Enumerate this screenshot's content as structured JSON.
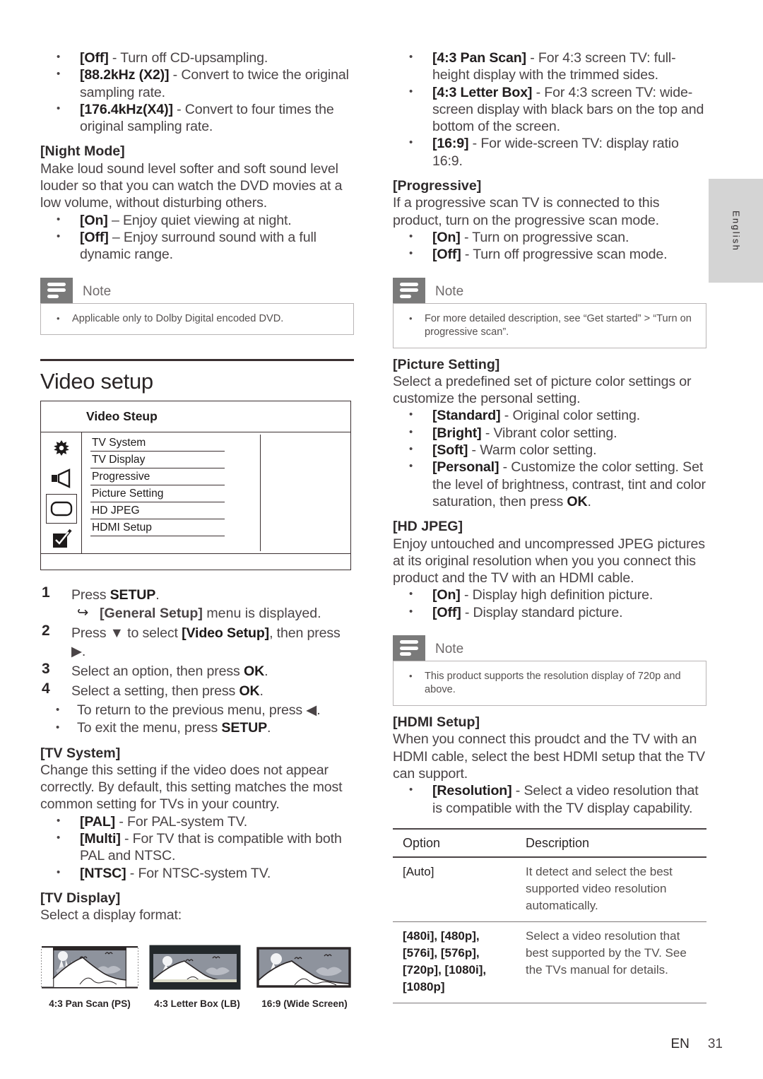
{
  "lang_tab": {
    "label": "English"
  },
  "footer": {
    "code": "EN",
    "page": "31"
  },
  "left": {
    "upsampling_bullets": [
      {
        "term": "[Off]",
        "rest": " - Turn off CD-upsampling."
      },
      {
        "term": "[88.2kHz (X2)]",
        "rest": " - Convert to twice the original sampling rate."
      },
      {
        "term": "[176.4kHz(X4)]",
        "rest": " - Convert to four times the original sampling rate."
      }
    ],
    "night_mode": {
      "heading": "[Night Mode]",
      "body": "Make loud sound level softer and soft sound level louder so that you can watch the DVD movies at a low volume, without disturbing others.",
      "bullets": [
        {
          "term": "[On]",
          "rest": " – Enjoy quiet viewing at night."
        },
        {
          "term": "[Off]",
          "rest": " – Enjoy surround sound with a full dynamic range."
        }
      ]
    },
    "note1": {
      "title": "Note",
      "items": [
        "Applicable only to Dolby Digital encoded DVD."
      ]
    },
    "section": {
      "title": "Video setup"
    },
    "osd": {
      "title": "Video Steup",
      "items": [
        "TV System",
        "TV Display",
        "Progressive",
        "Picture Setting",
        "HD JPEG",
        "HDMI Setup"
      ],
      "icons": [
        "gear-icon",
        "speaker-icon",
        "tv-screen-icon",
        "checkbox-icon"
      ]
    },
    "steps": [
      {
        "num": "1",
        "text_html": "Press <b>SETUP</b>.",
        "sub": "<b>[General Setup]</b> menu is displayed."
      },
      {
        "num": "2",
        "text_html": "Press ▼ to select <b>[Video Setup]</b>, then press ▶."
      },
      {
        "num": "3",
        "text_html": "Select an option, then press <b>OK</b>."
      },
      {
        "num": "4",
        "text_html": "Select a setting, then press <b>OK</b>."
      }
    ],
    "step_bullets": [
      "To return to the previous menu, press ◀.",
      "To exit the menu, press <b>SETUP</b>."
    ],
    "tv_system": {
      "heading": "[TV System]",
      "body": "Change this setting if the video does not appear correctly. By default, this setting matches the most common setting for TVs in your country.",
      "bullets": [
        {
          "term": "[PAL]",
          "rest": " - For PAL-system TV."
        },
        {
          "term": "[Multi]",
          "rest": " - For TV that is compatible with both PAL and NTSC."
        },
        {
          "term": "[NTSC]",
          "rest": " - For NTSC-system TV."
        }
      ]
    },
    "tv_display": {
      "heading": "[TV Display]",
      "body": "Select a display format:",
      "thumbnails": [
        {
          "name": "pan-scan-thumbnail",
          "caption": "4:3 Pan Scan (PS)"
        },
        {
          "name": "letter-box-thumbnail",
          "caption": "4:3 Letter Box (LB)"
        },
        {
          "name": "wide-screen-thumbnail",
          "caption": "16:9 (Wide Screen)"
        }
      ]
    }
  },
  "right": {
    "display_bullets": [
      {
        "term": "[4:3 Pan Scan]",
        "rest": " - For 4:3 screen TV: full-height display with the trimmed sides."
      },
      {
        "term": "[4:3 Letter Box]",
        "rest": " - For 4:3 screen TV: wide-screen display with black bars on the top and bottom of the screen."
      },
      {
        "term": "[16:9]",
        "rest": " - For wide-screen TV: display ratio 16:9."
      }
    ],
    "progressive": {
      "heading": "[Progressive]",
      "body": "If a progressive scan TV is connected to this product, turn on the progressive scan mode.",
      "bullets": [
        {
          "term": "[On]",
          "rest": " - Turn on progressive scan."
        },
        {
          "term": "[Off]",
          "rest": " - Turn off progressive scan mode."
        }
      ]
    },
    "note2": {
      "title": "Note",
      "items": [
        "For more detailed description, see “Get started” > “Turn on progressive scan”."
      ]
    },
    "picture_setting": {
      "heading": "[Picture Setting]",
      "body": "Select a predefined set of picture color settings or customize the personal setting.",
      "bullets": [
        {
          "term": "[Standard]",
          "rest": " - Original color setting."
        },
        {
          "term": "[Bright]",
          "rest": " - Vibrant color setting."
        },
        {
          "term": "[Soft]",
          "rest": " - Warm color setting."
        },
        {
          "term": "[Personal]",
          "rest": " - Customize the color setting. Set the level of brightness, contrast, tint and color saturation, then press <b>OK</b>."
        }
      ]
    },
    "hd_jpeg": {
      "heading": "[HD JPEG]",
      "body": "Enjoy untouched and uncompressed JPEG pictures at its original resolution when you you connect this product and the TV with an HDMI cable.",
      "bullets": [
        {
          "term": "[On]",
          "rest": " - Display high definition picture."
        },
        {
          "term": "[Off]",
          "rest": " - Display standard picture."
        }
      ]
    },
    "note3": {
      "title": "Note",
      "items": [
        "This product supports the resolution display of 720p and above."
      ]
    },
    "hdmi_setup": {
      "heading": "[HDMI Setup]",
      "body": "When you connect this proudct and the TV with an HDMI cable, select the best HDMI setup that the TV can support.",
      "bullets": [
        {
          "term": "[Resolution]",
          "rest": " - Select a video resolution that is compatible with the TV display capability."
        }
      ]
    },
    "table": {
      "headers": [
        "Option",
        "Description"
      ],
      "rows": [
        {
          "option": "[Auto]",
          "bold": false,
          "description": "It detect and select the best supported video resolution automatically."
        },
        {
          "option": "[480i], [480p], [576i], [576p], [720p], [1080i], [1080p]",
          "bold": true,
          "description": "Select a video resolution that best supported by the TV.  See the TVs manual for details."
        }
      ]
    }
  }
}
